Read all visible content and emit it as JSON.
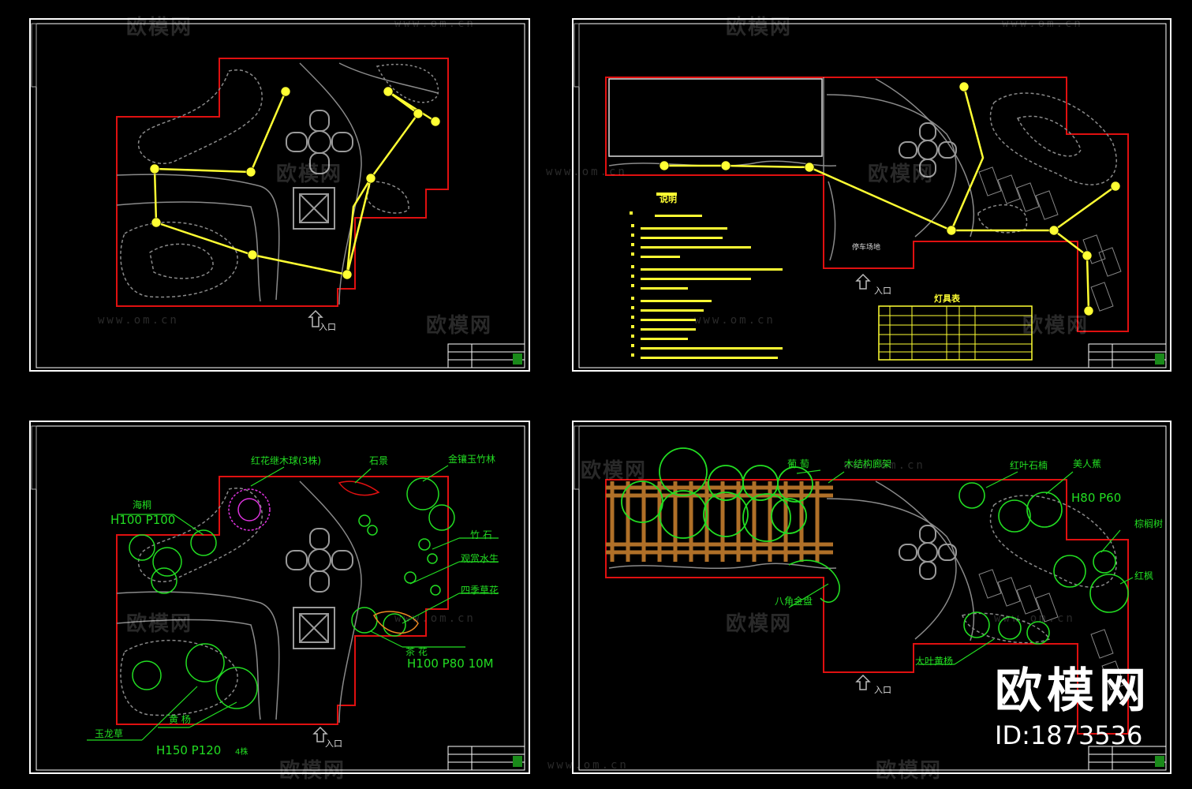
{
  "entrance_label": "入口",
  "labels_top_right": {
    "parking_note": "停车场地",
    "notes_title": "说明",
    "table_title": "灯具表"
  },
  "labels_bottom_left": {
    "shrub_spec": "H100 P100",
    "shrub_name": "海桐",
    "ornamental_tree": "红花继木球(3株)",
    "rock": "石景",
    "bamboo_group": "金镶玉竹林",
    "item_a": "竹 石",
    "item_b": "观赏水生",
    "item_c": "四季草花",
    "hedge_name": "茶 花",
    "hedge_spec": "H100 P80 10M",
    "ground_cover": "玉龙草",
    "boxwood": "黄 杨",
    "boxwood_spec": "H150 P120",
    "boxwood_count": "4株"
  },
  "labels_bottom_right": {
    "grape": "葡 萄",
    "wood_pergola": "木结构廊架",
    "sweet_osmanthus": "红叶石楠",
    "palm_spec": "H80 P60",
    "palm_name": "美人蕉",
    "fan_palm": "棕榈树",
    "maple": "红枫",
    "fern": "八角金盘",
    "bamboo_row": "大叶黄杨"
  },
  "watermark": {
    "brand": "欧模网",
    "url": "www.om.cn"
  },
  "badge": {
    "brand": "欧模网",
    "id": "ID:1873536"
  },
  "colors": {
    "frame": "#ffffff",
    "boundary": "#e01010",
    "lighting": "#ffff33",
    "plant": "#22dd22",
    "magenta": "#dd33dd",
    "pergola": "#b07028",
    "path": "#9a9a9a"
  }
}
